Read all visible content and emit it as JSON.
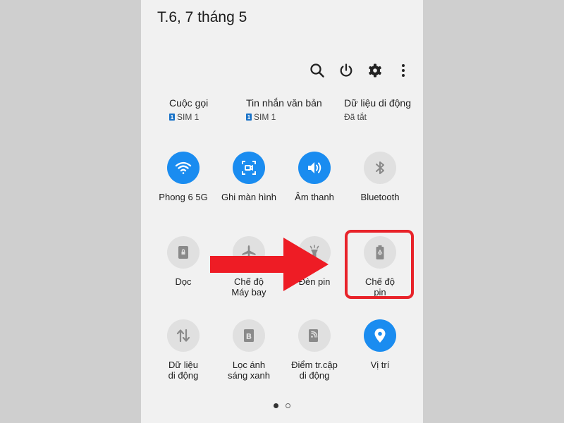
{
  "header": {
    "date": "T.6, 7 tháng 5"
  },
  "toolbar": {
    "icons": [
      "search-icon",
      "power-icon",
      "gear-icon",
      "more-vertical-icon"
    ]
  },
  "sim_row": [
    {
      "title": "Cuộc gọi",
      "badge": "1",
      "sub": "SIM 1"
    },
    {
      "title": "Tin nhắn văn bản",
      "badge": "1",
      "sub": "SIM 1"
    },
    {
      "title": "Dữ liệu di động",
      "badge": "",
      "sub": "Đã tắt"
    }
  ],
  "tiles": [
    {
      "label": "Phong 6 5G",
      "icon": "wifi-icon",
      "active": true
    },
    {
      "label": "Ghi màn hình",
      "icon": "screen-record-icon",
      "active": true
    },
    {
      "label": "Âm thanh",
      "icon": "volume-icon",
      "active": true
    },
    {
      "label": "Bluetooth",
      "icon": "bluetooth-icon",
      "active": false
    },
    {
      "label": "Dọc",
      "icon": "portrait-lock-icon",
      "active": false
    },
    {
      "label": "Chế độ\nMáy bay",
      "icon": "airplane-icon",
      "active": false
    },
    {
      "label": "Đèn pin",
      "icon": "flashlight-icon",
      "active": false
    },
    {
      "label": "Chế độ\npin",
      "icon": "battery-saver-icon",
      "active": false
    },
    {
      "label": "Dữ liệu\ndi động",
      "icon": "mobile-data-icon",
      "active": false
    },
    {
      "label": "Lọc ánh\nsáng xanh",
      "icon": "blue-light-filter-icon",
      "active": false
    },
    {
      "label": "Điểm tr.cập\ndi động",
      "icon": "hotspot-icon",
      "active": false
    },
    {
      "label": "Vị trí",
      "icon": "location-icon",
      "active": true
    }
  ],
  "pagination": {
    "pages": 2,
    "current": 1
  },
  "colors": {
    "accent": "#1a8cf0",
    "highlight": "#e8232a",
    "arrow": "#ee1c25",
    "panel_bg": "#f1f1f1",
    "outer_bg": "#cfcfcf"
  }
}
